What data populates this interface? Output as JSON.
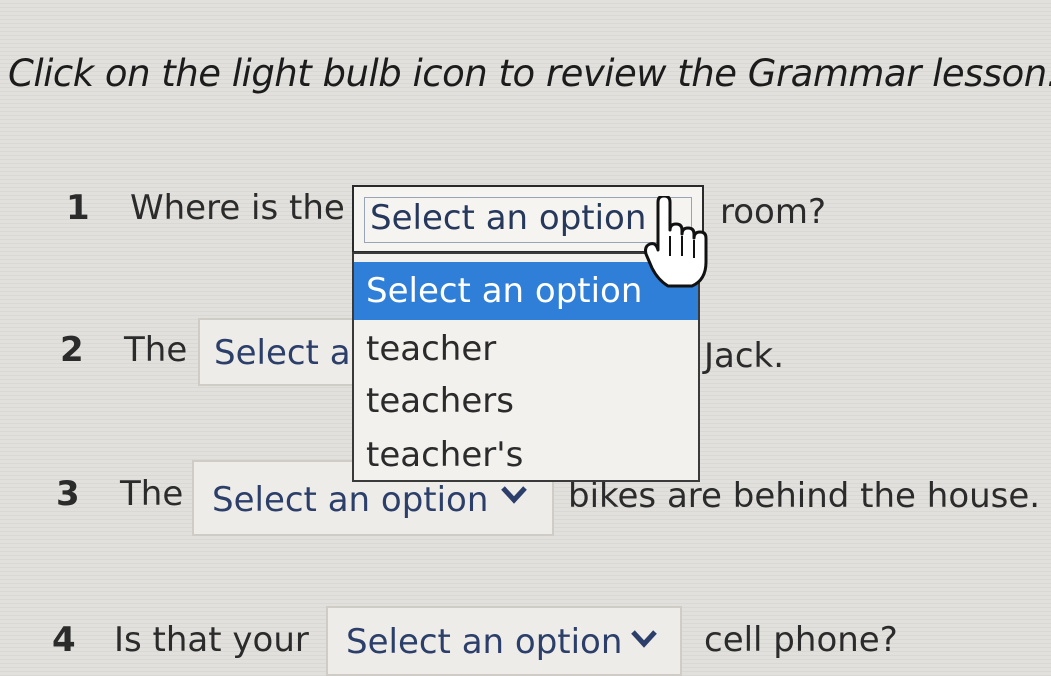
{
  "instruction": "Click on the light bulb icon to review the Grammar lesson.",
  "questions": [
    {
      "number": "1",
      "before": "Where is the",
      "select_value": "Select an option",
      "after": "room?",
      "state": "open"
    },
    {
      "number": "2",
      "before": "The",
      "select_value": "Select a",
      "after": "Jack.",
      "state": "partially hidden"
    },
    {
      "number": "3",
      "before": "The",
      "select_value": "Select an option",
      "after": "bikes are behind the house."
    },
    {
      "number": "4",
      "before": "Is that your",
      "select_value": "Select an option",
      "after": "cell phone?"
    }
  ],
  "dropdown": {
    "options": [
      "Select an option",
      "teacher",
      "teachers",
      "teacher's"
    ],
    "highlighted_option": "Select an option"
  },
  "icons": {
    "cursor": "hand-pointer-icon",
    "chevron": "chevron-down-icon"
  },
  "colors": {
    "highlight": "#2f7fd8",
    "select_text": "#2c3f6a",
    "background": "#e2e0dc"
  }
}
